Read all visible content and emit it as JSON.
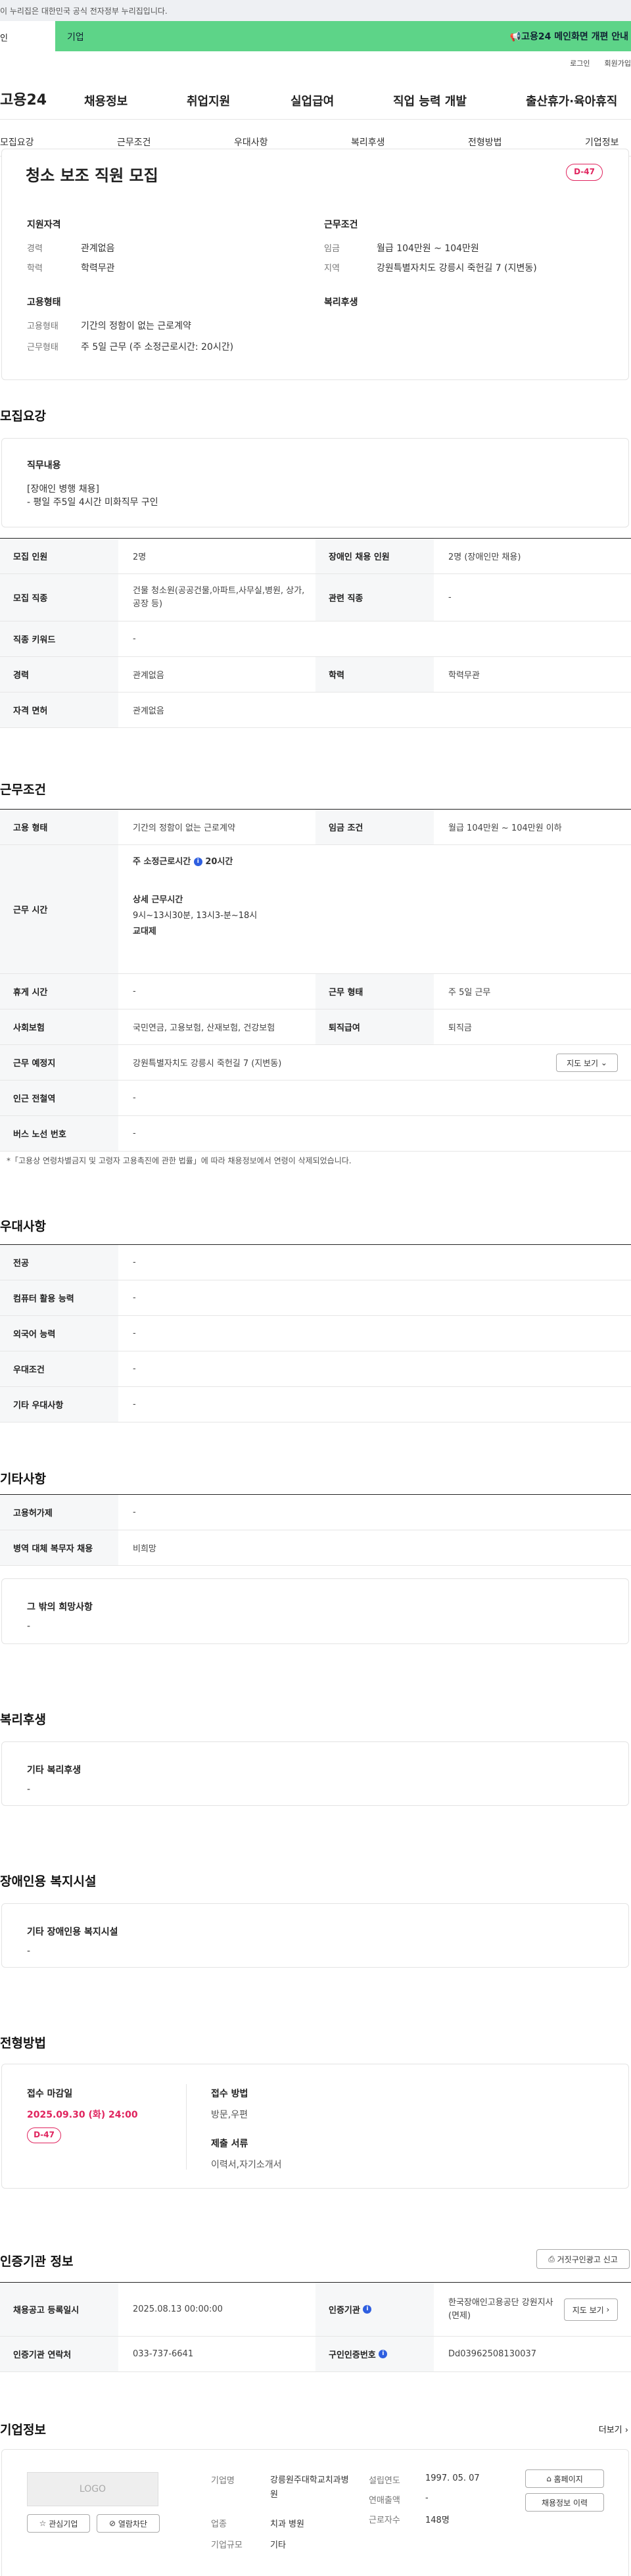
{
  "gov_notice": "이 누리집은 대한민국 공식 전자정부 누리집입니다.",
  "banner": {
    "left": "인",
    "tag": "기업",
    "right": "고용24 메인화면 개편 안내"
  },
  "util": [
    "로그인",
    "회원가입"
  ],
  "gnb": {
    "logo": "고용24",
    "menus": [
      "채용정보",
      "취업지원",
      "실업급여",
      "직업 능력 개발",
      "출산휴가·육아휴직"
    ]
  },
  "tabs": [
    "모집요강",
    "근무조건",
    "우대사항",
    "복리후생",
    "전형방법",
    "기업정보"
  ],
  "job": {
    "title": "청소 보조 직원 모집",
    "dday": "D-47",
    "qual_title": "지원자격",
    "qual": [
      {
        "k": "경력",
        "v": "관계없음"
      },
      {
        "k": "학력",
        "v": "학력무관"
      }
    ],
    "cond_title": "근무조건",
    "cond": [
      {
        "k": "임금",
        "v": "월급 104만원 ~ 104만원"
      },
      {
        "k": "지역",
        "v": "강원특별자치도 강릉시 죽헌길 7 (지변동)"
      }
    ],
    "emp_title": "고용형태",
    "emp": [
      {
        "k": "고용형태",
        "v": "기간의 정함이 없는 근로계약"
      },
      {
        "k": "근무형태",
        "v": "주 5일 근무 (주 소정근로시간: 20시간)"
      }
    ],
    "welfare_title": "복리후생"
  },
  "recruit": {
    "section": "모집요강",
    "duty_title": "직무내용",
    "duty_lines": [
      "[장애인 병행 채용]",
      "- 평일 주5일 4시간 미화직무 구인"
    ],
    "rows": [
      {
        "th": "모집 인원",
        "td": "2명",
        "th2": "장애인 채용 인원",
        "td2": "2명 (장애인만 채용)"
      },
      {
        "th": "모집 직종",
        "td": "건물 청소원(공공건물,아파트,사무실,병원, 상가,공장 등)",
        "th2": "관련 직종",
        "td2": "-"
      },
      {
        "th": "직종 키워드",
        "td": "-"
      },
      {
        "th": "경력",
        "td": "관계없음",
        "th2": "학력",
        "td2": "학력무관"
      },
      {
        "th": "자격 면허",
        "td": "관계없음"
      }
    ]
  },
  "work": {
    "section": "근무조건",
    "emp": {
      "th": "고용 형태",
      "td": "기간의 정함이 없는 근로계약",
      "th2": "임금 조건",
      "td2": "월급 104만원 ~ 104만원 이하"
    },
    "hours": {
      "th": "근무 시간",
      "weekly_label": "주 소정근로시간",
      "weekly_value": "20시간",
      "detail_label": "상세 근무시간",
      "detail_value": "9시~13시30분, 13시3-분~18시",
      "shift": "교대제"
    },
    "rest": {
      "th": "휴게 시간",
      "td": "-",
      "th2": "근무 형태",
      "td2": "주 5일 근무"
    },
    "ins": {
      "th": "사회보험",
      "td": "국민연금, 고용보험, 산재보험, 건강보험",
      "th2": "퇴직급여",
      "td2": "퇴직금"
    },
    "loc": {
      "th": "근무 예정지",
      "td": "강원특별자치도 강릉시 죽헌길 7 (지변동)",
      "btn": "지도 보기"
    },
    "subway": {
      "th": "인근 전철역",
      "td": "-"
    },
    "bus": {
      "th": "버스 노선 번호",
      "td": "-"
    },
    "note": "*「고용상 연령차별금지 및 고령자 고용촉진에 관한 법률」에 따라 채용정보에서 연령이 삭제되었습니다."
  },
  "pref": {
    "section": "우대사항",
    "rows": [
      {
        "th": "전공",
        "td": "-"
      },
      {
        "th": "컴퓨터 활용 능력",
        "td": "-"
      },
      {
        "th": "외국어 능력",
        "td": "-"
      },
      {
        "th": "우대조건",
        "td": "-"
      },
      {
        "th": "기타 우대사항",
        "td": "-"
      }
    ]
  },
  "etc": {
    "section": "기타사항",
    "rows": [
      {
        "th": "고용허가제",
        "td": "-"
      },
      {
        "th": "병역 대체 복무자 채용",
        "td": "비희망"
      }
    ],
    "hope_title": "그 밖의 희망사항",
    "hope_value": "-"
  },
  "welfare": {
    "section": "복리후생",
    "title": "기타 복리후생",
    "value": "-"
  },
  "facility": {
    "section": "장애인용 복지시설",
    "title": "기타 장애인용 복지시설",
    "value": "-"
  },
  "process": {
    "section": "전형방법",
    "deadline_label": "접수 마감일",
    "deadline": "2025.09.30 (화) 24:00",
    "dday": "D-47",
    "method_label": "접수 방법",
    "method": "방문,우편",
    "docs_label": "제출 서류",
    "docs": "이력서,자기소개서"
  },
  "agency": {
    "section": "인증기관 정보",
    "report_btn": "거짓구인광고 신고",
    "reg_th": "채용공고 등록일시",
    "reg_td": "2025.08.13 00:00:00",
    "org_th": "인증기관",
    "org_td": "한국장애인고용공단 강원지사(면제)",
    "map_btn": "지도 보기",
    "tel_th": "인증기관 연락처",
    "tel_td": "033-737-6641",
    "no_th": "구인인증번호",
    "no_td": "Dd03962508130037"
  },
  "company": {
    "section": "기업정보",
    "more": "더보기",
    "logo": "LOGO",
    "interest_btn": "관심기업",
    "block_btn": "열람차단",
    "name_k": "기업명",
    "name_v": "강릉원주대학교치과병원",
    "ind_k": "업종",
    "ind_v": "치과 병원",
    "size_k": "기업규모",
    "size_v": "기타",
    "est_k": "설립연도",
    "est_v": "1997. 05. 07",
    "sales_k": "연매출액",
    "sales_v": "-",
    "emp_k": "근로자수",
    "emp_v": "148명",
    "home_btn": "홈페이지",
    "jobs_btn": "채용정보 이력"
  }
}
